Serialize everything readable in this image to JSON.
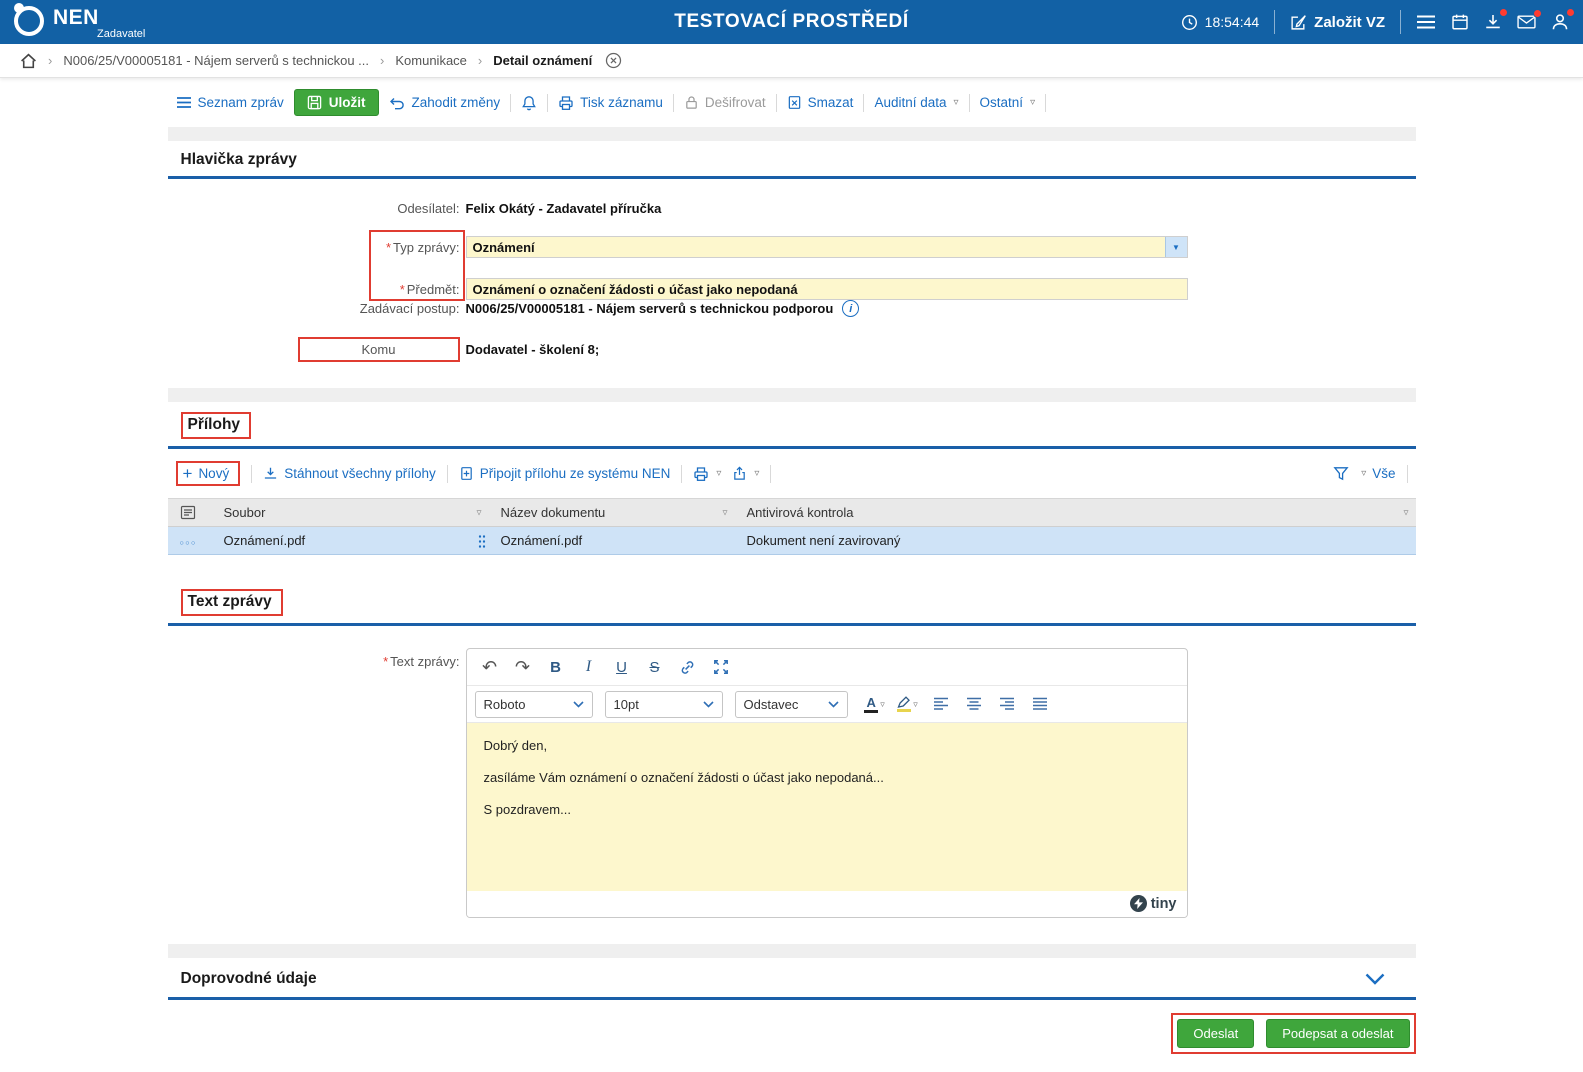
{
  "topbar": {
    "brand": "NEN",
    "brand_sub": "Zadavatel",
    "env_title": "TESTOVACÍ PROSTŘEDÍ",
    "time": "18:54:44",
    "zalozit_vz": "Založit VZ"
  },
  "breadcrumb": {
    "item1": "N006/25/V00005181 - Nájem serverů s technickou ...",
    "item2": "Komunikace",
    "item3": "Detail oznámení"
  },
  "toolbar": {
    "seznam_zprav": "Seznam zpráv",
    "ulozit": "Uložit",
    "zahodit_zmeny": "Zahodit změny",
    "tisk_zaznamu": "Tisk záznamu",
    "desifrovat": "Dešifrovat",
    "smazat": "Smazat",
    "auditni_data": "Auditní data",
    "ostatni": "Ostatní"
  },
  "hlavicka": {
    "title": "Hlavička zprávy",
    "odesilatel_label": "Odesílatel:",
    "odesilatel_value": "Felix Okátý - Zadavatel příručka",
    "typ_zpravy_label": "Typ zprávy:",
    "typ_zpravy_value": "Oznámení",
    "predmet_label": "Předmět:",
    "predmet_value": "Oznámení o označení žádosti o účast jako nepodaná",
    "zadavaci_postup_label": "Zadávací postup:",
    "zadavaci_postup_value": "N006/25/V00005181 - Nájem serverů s technickou podporou",
    "komu_label": "Komu",
    "komu_value": "Dodavatel - školení 8;"
  },
  "prilohy": {
    "title": "Přílohy",
    "novy": "Nový",
    "stahnout_vse": "Stáhnout všechny přílohy",
    "pripojit": "Připojit přílohu ze systému NEN",
    "vse": "Vše",
    "col_soubor": "Soubor",
    "col_nazev": "Název dokumentu",
    "col_antivir": "Antivirová kontrola",
    "row": {
      "soubor": "Oznámení.pdf",
      "nazev": "Oznámení.pdf",
      "antivir": "Dokument není zavirovaný"
    }
  },
  "text_zpravy": {
    "title": "Text zprávy",
    "label": "Text zprávy:",
    "font": "Roboto",
    "font_size": "10pt",
    "block": "Odstavec",
    "line1": "Dobrý den,",
    "line2": "zasíláme Vám oznámení o označení žádosti o účast jako nepodaná...",
    "line3": "S pozdravem...",
    "brand": "tiny"
  },
  "doprovodne": {
    "title": "Doprovodné údaje"
  },
  "footer": {
    "odeslat": "Odeslat",
    "podepsat_a_odeslat": "Podepsat a odeslat"
  },
  "icons": {
    "breadcrumb_sep": "›",
    "chevron_small": "▿",
    "chevron_select": "▼",
    "required": "*",
    "plus": "+",
    "undo_arrow": "↶",
    "redo_arrow": "↷",
    "row_menu": "○○○",
    "bold": "B",
    "italic": "I",
    "underline": "U",
    "strikethrough": "S",
    "color_letter": "A"
  },
  "colors": {
    "header_blue": "#1261a5",
    "link_blue": "#1b6ec2",
    "button_green": "#3fa63c",
    "field_yellow": "#fdf7cd",
    "annotation_red": "#e03c31",
    "selected_row_blue": "#cfe3f7",
    "section_underline_blue": "#1a5fa8"
  }
}
